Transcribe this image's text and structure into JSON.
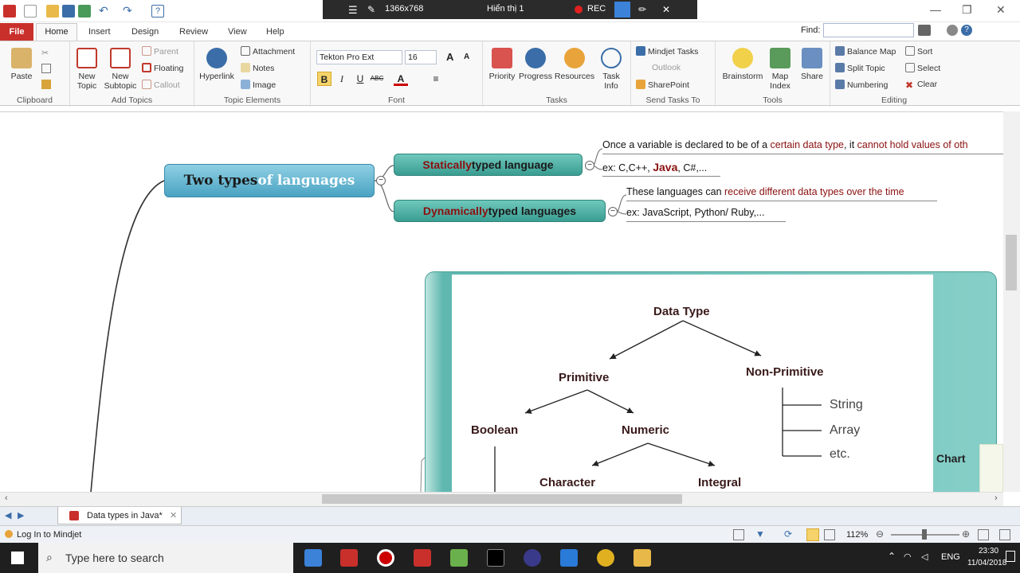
{
  "quick_access": {
    "title_fragment": ""
  },
  "recorder": {
    "resolution": "1366x768",
    "display": "Hiển thị 1",
    "rec": "REC"
  },
  "tabs": {
    "file": "File",
    "home": "Home",
    "insert": "Insert",
    "design": "Design",
    "review": "Review",
    "view": "View",
    "help": "Help"
  },
  "find": {
    "label": "Find:",
    "value": ""
  },
  "ribbon": {
    "clipboard": {
      "paste": "Paste",
      "label": "Clipboard"
    },
    "add_topics": {
      "new_topic": "New Topic",
      "new_subtopic": "New Subtopic",
      "parent": "Parent",
      "floating": "Floating",
      "callout": "Callout",
      "label": "Add Topics"
    },
    "topic_elements": {
      "hyperlink": "Hyperlink",
      "attachment": "Attachment",
      "notes": "Notes",
      "image": "Image",
      "label": "Topic Elements"
    },
    "font": {
      "name": "Tekton Pro Ext",
      "size": "16",
      "label": "Font",
      "bold": "B",
      "italic": "I",
      "underline": "U",
      "strike": "ABC"
    },
    "tasks": {
      "priority": "Priority",
      "progress": "Progress",
      "resources": "Resources",
      "task_info": "Task Info",
      "label": "Tasks"
    },
    "send_tasks": {
      "mindjet_tasks": "Mindjet Tasks",
      "outlook": "Outlook",
      "sharepoint": "SharePoint",
      "label": "Send Tasks To"
    },
    "tools": {
      "brainstorm": "Brainstorm",
      "map_index": "Map Index",
      "share": "Share",
      "label": "Tools"
    },
    "editing": {
      "balance_map": "Balance Map",
      "sort": "Sort",
      "split_topic": "Split Topic",
      "select": "Select",
      "numbering": "Numbering",
      "clear": "Clear",
      "label": "Editing"
    }
  },
  "map": {
    "central_a": "Two types",
    "central_b": " of languages",
    "static_a": "Statically",
    "static_b": " typed language",
    "dynamic_a": "Dynamically",
    "dynamic_b": " typed languages",
    "static_note1_a": "Once a variable is declared to be of a ",
    "static_note1_b": "certain data type",
    "static_note1_c": ", it ",
    "static_note1_d": "cannot hold values of oth",
    "static_note2_a": "ex: C,C++, ",
    "static_note2_b": "Java",
    "static_note2_c": ", C#,...",
    "dynamic_note1_a": "These languages can ",
    "dynamic_note1_b": "receive different data types over the time",
    "dynamic_note2": "ex: JavaScript, Python/ Ruby,..."
  },
  "diagram": {
    "root": "Data Type",
    "primitive": "Primitive",
    "non_primitive": "Non-Primitive",
    "boolean": "Boolean",
    "numeric": "Numeric",
    "character": "Character",
    "integral": "Integral",
    "string": "String",
    "array": "Array",
    "etc": "etc.",
    "chart": "Chart"
  },
  "document_tab": {
    "name": "Data types in Java*"
  },
  "status": {
    "login": "Log In to Mindjet",
    "zoom": "112%"
  },
  "taskbar": {
    "search_placeholder": "Type here to search",
    "lang": "ENG",
    "time": "23:30",
    "date": "11/04/2018"
  }
}
